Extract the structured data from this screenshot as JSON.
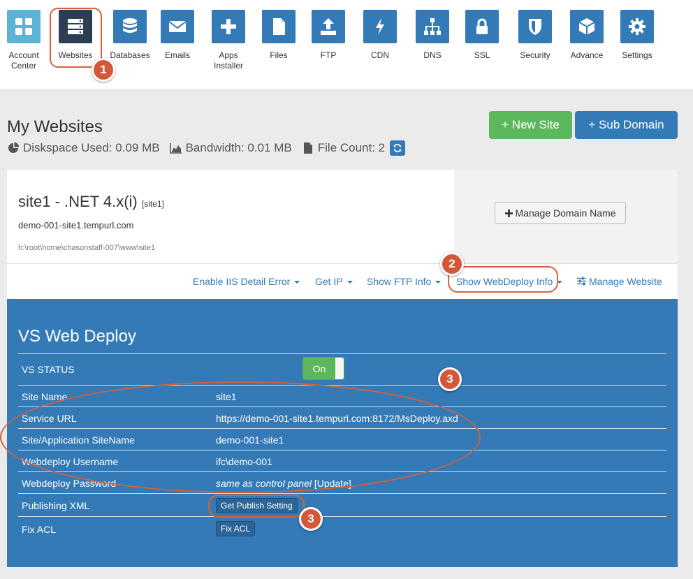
{
  "nav": {
    "items": [
      {
        "label": "Account Center",
        "icon": "grid-icon"
      },
      {
        "label": "Websites",
        "icon": "server-icon"
      },
      {
        "label": "Databases",
        "icon": "database-icon"
      },
      {
        "label": "Emails",
        "icon": "envelope-icon"
      },
      {
        "label": "Apps Installer",
        "icon": "plus-icon"
      },
      {
        "label": "Files",
        "icon": "file-icon"
      },
      {
        "label": "FTP",
        "icon": "upload-icon"
      },
      {
        "label": "CDN",
        "icon": "bolt-icon"
      },
      {
        "label": "DNS",
        "icon": "sitemap-icon"
      },
      {
        "label": "SSL",
        "icon": "lock-icon"
      },
      {
        "label": "Security",
        "icon": "shield-icon"
      },
      {
        "label": "Advance",
        "icon": "cube-icon"
      },
      {
        "label": "Settings",
        "icon": "gear-icon"
      }
    ]
  },
  "annotations": {
    "one": "1",
    "two": "2",
    "three": "3"
  },
  "header": {
    "title": "My Websites",
    "diskspace": "Diskspace Used: 0.09 MB",
    "bandwidth": "Bandwidth: 0.01 MB",
    "filecount": "File Count: 2",
    "new_site": "+ New Site",
    "sub_domain": "+ Sub Domain"
  },
  "site": {
    "title": "site1 - .NET 4.x(i)",
    "tag": "[site1]",
    "domain": "demo-001-site1.tempurl.com",
    "path": "h:\\root\\home\\chasonstaff-007\\www\\site1",
    "manage_domain": "Manage Domain Name"
  },
  "actions": {
    "iis": "Enable IIS Detail Error",
    "ip": "Get IP",
    "ftp": "Show FTP Info",
    "webdeploy": "Show WebDeploy Info",
    "manage": "Manage Website"
  },
  "deploy": {
    "title": "VS Web Deploy",
    "status_label": "VS STATUS",
    "status_value": "On",
    "rows": [
      {
        "key": "Site Name",
        "value": "site1"
      },
      {
        "key": "Service URL",
        "value": "https://demo-001-site1.tempurl.com:8172/MsDeploy.axd"
      },
      {
        "key": "Site/Application SiteName",
        "value": "demo-001-site1"
      },
      {
        "key": "Webdeploy Username",
        "value": "ifc\\demo-001"
      }
    ],
    "password_label": "Webdeploy Password",
    "password_value": "same as control panel",
    "password_update": "[Update]",
    "xml_label": "Publishing XML",
    "xml_button": "Get Publish Setting",
    "acl_label": "Fix ACL",
    "acl_button": "Fix ACL"
  },
  "colors": {
    "primary": "#337ab7",
    "success": "#5cb85c",
    "annotation": "#d4573a"
  }
}
